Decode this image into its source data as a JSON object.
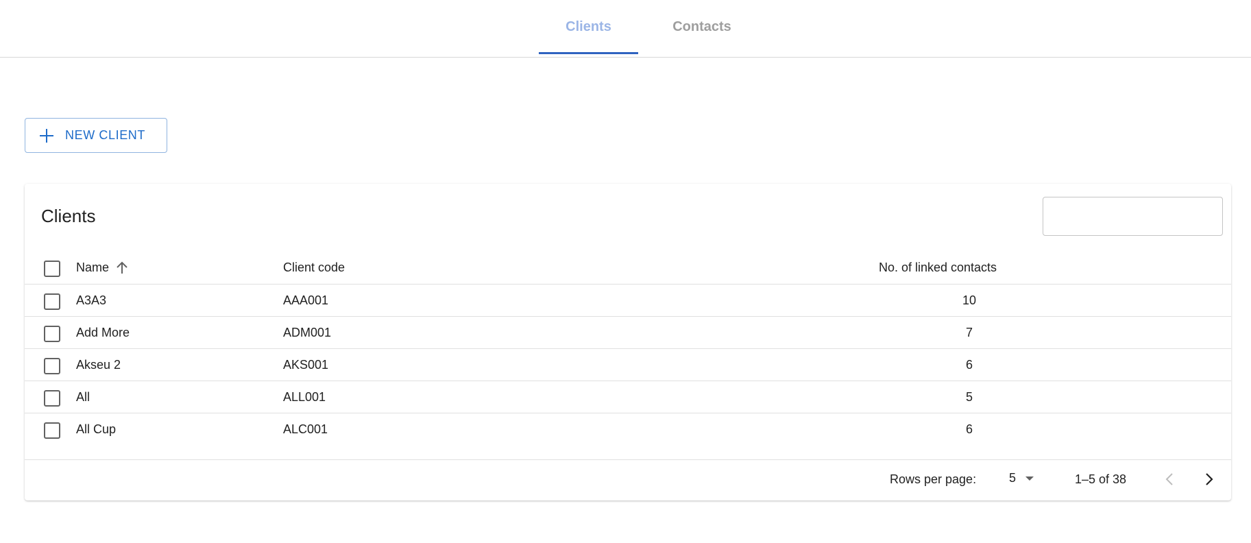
{
  "tabs": [
    {
      "label": "Clients",
      "active": true
    },
    {
      "label": "Contacts",
      "active": false
    }
  ],
  "toolbar": {
    "new_client_label": "NEW CLIENT"
  },
  "table": {
    "title": "Clients",
    "search_value": "",
    "columns": {
      "name": "Name",
      "code": "Client code",
      "count": "No. of linked contacts"
    },
    "sort": {
      "column": "name",
      "direction": "ascending",
      "icon": "arrow-up-icon"
    },
    "rows": [
      {
        "name": "A3A3",
        "code": "AAA001",
        "count": "10"
      },
      {
        "name": "Add More",
        "code": "ADM001",
        "count": "7"
      },
      {
        "name": "Akseu 2",
        "code": "AKS001",
        "count": "6"
      },
      {
        "name": "All",
        "code": "ALL001",
        "count": "5"
      },
      {
        "name": "All Cup",
        "code": "ALC001",
        "count": "6"
      }
    ]
  },
  "pagination": {
    "rows_per_page_label": "Rows per page:",
    "rows_per_page_value": "5",
    "range_label": "1–5 of 38"
  },
  "colors": {
    "accent": "#1d6bc9",
    "tab_indicator": "#2f63c0",
    "tab_active_text": "#9bb5e6",
    "tab_inactive_text": "#9e9e9e"
  }
}
